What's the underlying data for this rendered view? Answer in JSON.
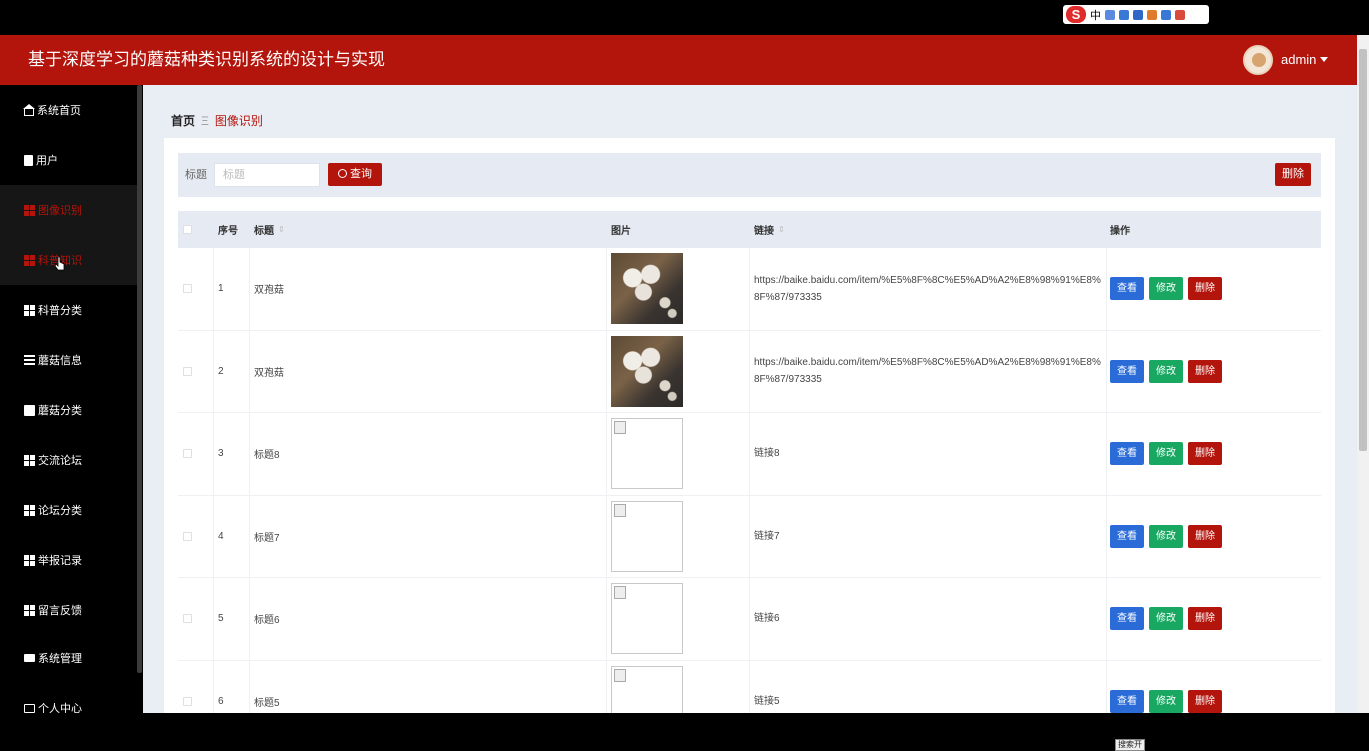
{
  "app": {
    "title": "基于深度学习的蘑菇种类识别系统的设计与实现",
    "user": "admin"
  },
  "ime": {
    "logo": "S",
    "mode": "中"
  },
  "sidebar": {
    "items": [
      {
        "label": "系统首页",
        "icon": "home-icon"
      },
      {
        "label": "用户",
        "icon": "clipboard-icon"
      },
      {
        "label": "图像识别",
        "icon": "grid-icon",
        "active": true
      },
      {
        "label": "科普知识",
        "icon": "grid-icon",
        "active": true
      },
      {
        "label": "科普分类",
        "icon": "grid-icon"
      },
      {
        "label": "蘑菇信息",
        "icon": "list-icon"
      },
      {
        "label": "蘑菇分类",
        "icon": "book-icon"
      },
      {
        "label": "交流论坛",
        "icon": "grid-icon"
      },
      {
        "label": "论坛分类",
        "icon": "grid-icon"
      },
      {
        "label": "举报记录",
        "icon": "grid-icon"
      },
      {
        "label": "留言反馈",
        "icon": "grid-icon"
      },
      {
        "label": "系统管理",
        "icon": "monitor-icon"
      },
      {
        "label": "个人中心",
        "icon": "card-icon"
      }
    ]
  },
  "breadcrumb": {
    "home": "首页",
    "separator": "Ξ",
    "current": "图像识别"
  },
  "search": {
    "label": "标题",
    "placeholder": "标题",
    "query_button": "查询",
    "delete_button": "删除"
  },
  "table": {
    "columns": {
      "index": "序号",
      "title": "标题",
      "image": "图片",
      "link": "链接",
      "actions": "操作"
    },
    "rows": [
      {
        "index": "1",
        "title": "双孢菇",
        "image": "mushroom-photo",
        "link": "https://baike.baidu.com/item/%E5%8F%8C%E5%AD%A2%E8%98%91%E8%8F%87/973335"
      },
      {
        "index": "2",
        "title": "双孢菇",
        "image": "mushroom-photo",
        "link": "https://baike.baidu.com/item/%E5%8F%8C%E5%AD%A2%E8%98%91%E8%8F%87/973335"
      },
      {
        "index": "3",
        "title": "标题8",
        "image": "broken",
        "link": "链接8"
      },
      {
        "index": "4",
        "title": "标题7",
        "image": "broken",
        "link": "链接7"
      },
      {
        "index": "5",
        "title": "标题6",
        "image": "broken",
        "link": "链接6"
      },
      {
        "index": "6",
        "title": "标题5",
        "image": "broken",
        "link": "链接5"
      }
    ],
    "actions": {
      "view": "查看",
      "edit": "修改",
      "delete": "删除"
    }
  },
  "tooltip": "搜索开",
  "colors": {
    "brand": "#b3140b",
    "view": "#2a6bd8",
    "edit": "#18a862",
    "sidebar": "#000000"
  }
}
